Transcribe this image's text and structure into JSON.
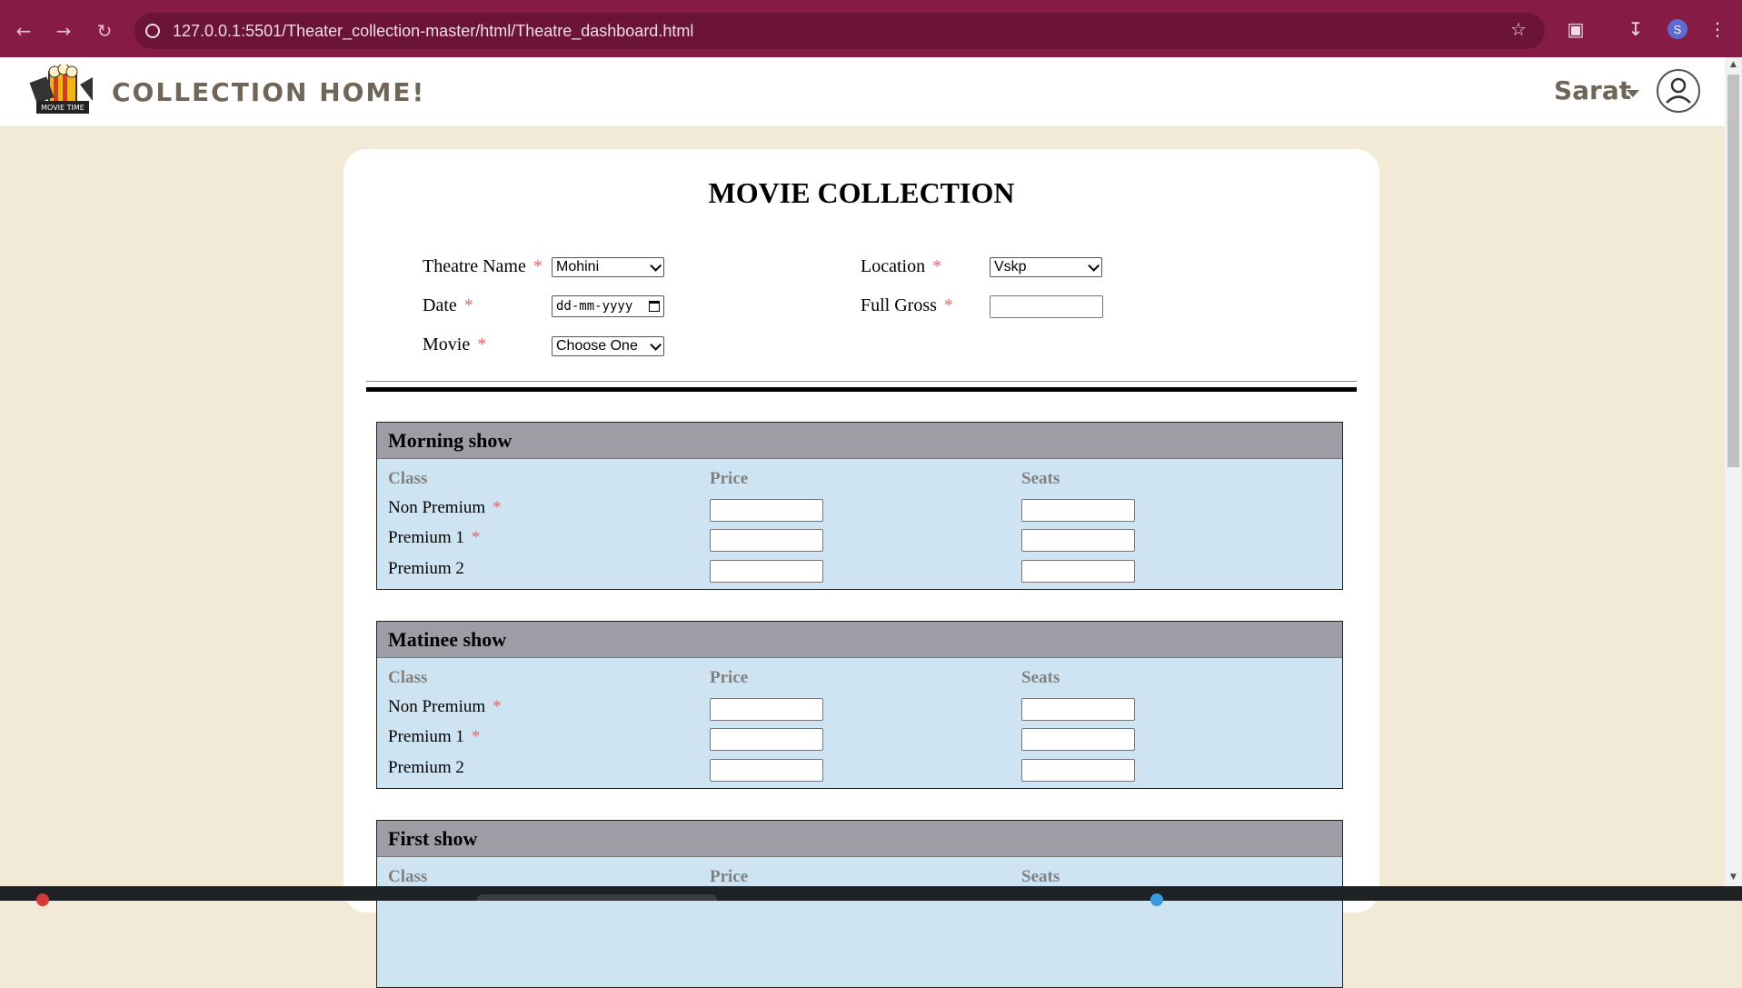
{
  "browser": {
    "url": "127.0.0.1:5501/Theater_collection-master/html/Theatre_dashboard.html",
    "profile_initial": "S"
  },
  "header": {
    "brand": "COLLECTION HOME!",
    "user": "Sarat"
  },
  "form": {
    "title": "MOVIE COLLECTION",
    "theatre_name_label": "Theatre Name",
    "theatre_name_value": "Mohini",
    "location_label": "Location",
    "location_value": "Vskp",
    "date_label": "Date",
    "date_placeholder": "dd-mm-yyyy",
    "full_gross_label": "Full Gross",
    "movie_label": "Movie",
    "movie_value": "Choose One",
    "required_mark": "*"
  },
  "shows": [
    {
      "title": "Morning show",
      "columns": [
        "Class",
        "Price",
        "Seats"
      ],
      "rows": [
        {
          "label": "Non Premium",
          "required": "*"
        },
        {
          "label": "Premium 1",
          "required": "*"
        },
        {
          "label": "Premium 2",
          "required": ""
        }
      ]
    },
    {
      "title": "Matinee show",
      "columns": [
        "Class",
        "Price",
        "Seats"
      ],
      "rows": [
        {
          "label": "Non Premium",
          "required": "*"
        },
        {
          "label": "Premium 1",
          "required": "*"
        },
        {
          "label": "Premium 2",
          "required": ""
        }
      ]
    },
    {
      "title": "First show",
      "columns": [
        "Class",
        "Price",
        "Seats"
      ],
      "rows": []
    }
  ]
}
